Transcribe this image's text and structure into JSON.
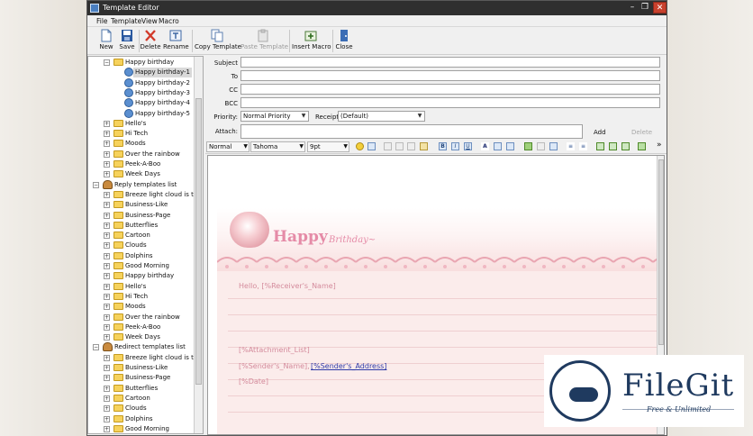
{
  "window": {
    "title": "Template Editor",
    "min": "–",
    "max": "❐",
    "close": "✕"
  },
  "menu": [
    "File",
    "Template",
    "View",
    "Macro"
  ],
  "toolbar": {
    "new": "New",
    "save": "Save",
    "delete": "Delete",
    "rename": "Rename",
    "copy_template": "Copy Template",
    "paste_template": "Paste Template",
    "insert_macro": "Insert Macro",
    "close": "Close"
  },
  "tree": {
    "group1_child": "Happy birthday",
    "selected_items": [
      "Happy birthday-1",
      "Happy birthday-2",
      "Happy birthday-3",
      "Happy birthday-4",
      "Happy birthday-5"
    ],
    "group1_rest": [
      "Hello's",
      "Hi Tech",
      "Moods",
      "Over the rainbow",
      "Peek-A-Boo",
      "Week Days"
    ],
    "reply_list": "Reply templates list",
    "reply_items": [
      "Breeze light cloud is thin",
      "Business-Like",
      "Business-Page",
      "Butterflies",
      "Cartoon",
      "Clouds",
      "Dolphins",
      "Good Morning",
      "Happy birthday",
      "Hello's",
      "Hi Tech",
      "Moods",
      "Over the rainbow",
      "Peek-A-Boo",
      "Week Days"
    ],
    "redirect_list": "Redirect templates list",
    "redirect_items": [
      "Breeze light cloud is thin",
      "Business-Like",
      "Business-Page",
      "Butterflies",
      "Cartoon",
      "Clouds",
      "Dolphins",
      "Good Morning"
    ],
    "expand": "+",
    "collapse": "−"
  },
  "form": {
    "subject": "Subject",
    "to": "To",
    "cc": "CC",
    "bcc": "BCC",
    "priority_label": "Priority:",
    "priority_value": "Normal Priority",
    "receipt_label": "Receipt:",
    "receipt_value": "(Default)",
    "attach_label": "Attach:",
    "add": "Add",
    "delete": "Delete"
  },
  "format": {
    "style": "Normal",
    "font": "Tahoma",
    "size": "9pt",
    "more": "»"
  },
  "card": {
    "title": "Happy",
    "subtitle": "Brithday~",
    "greeting": "Hello, [%Receiver's_Name]",
    "attachment": "[%Attachment_List]",
    "sender_name": "[%Sender's_Name],",
    "sender_address": "[%Sender's_Address]",
    "date": "[%Date]"
  },
  "watermark": {
    "name": "FileGit",
    "tagline": "Free & Unlimited"
  },
  "colors": {
    "accent": "#e58ba7",
    "link": "#2c39a8",
    "logo": "#1f3a5f"
  }
}
